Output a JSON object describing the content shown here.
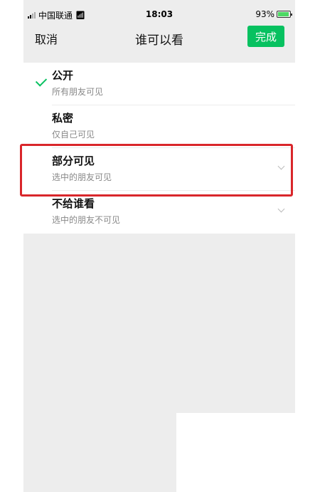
{
  "status_bar": {
    "carrier": "中国联通",
    "time": "18:03",
    "battery": "93%",
    "battery_level": 0.93
  },
  "nav": {
    "cancel_label": "取消",
    "title": "谁可以看",
    "done_label": "完成"
  },
  "options": [
    {
      "label": "公开",
      "sub": "所有朋友可见",
      "selected": true
    },
    {
      "label": "私密",
      "sub": "仅自己可见"
    },
    {
      "label": "部分可见",
      "sub": "选中的朋友可见",
      "highlighted": true
    },
    {
      "label": "不给谁看",
      "sub": "选中的朋友不可见"
    }
  ],
  "colors": {
    "accent": "#07c160",
    "highlight": "#d9262b",
    "background": "#ededed"
  }
}
